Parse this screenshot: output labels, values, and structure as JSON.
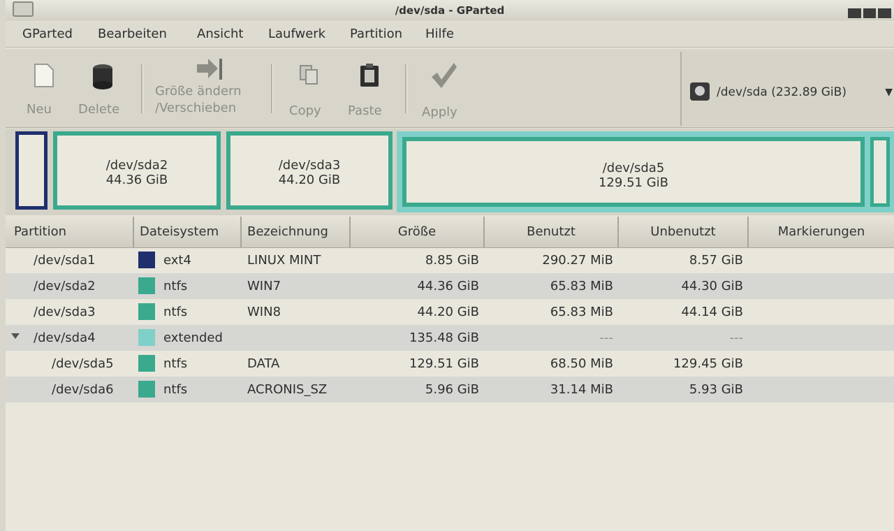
{
  "window": {
    "title": "/dev/sda - GParted"
  },
  "menu": {
    "items": [
      {
        "label": "GParted"
      },
      {
        "label": "Bearbeiten"
      },
      {
        "label": "Ansicht"
      },
      {
        "label": "Laufwerk"
      },
      {
        "label": "Partition"
      },
      {
        "label": "Hilfe"
      }
    ]
  },
  "toolbar": {
    "new_label": "Neu",
    "delete_label": "Delete",
    "resize_label_1": "Größe ändern",
    "resize_label_2": "/Verschieben",
    "copy_label": "Copy",
    "paste_label": "Paste",
    "apply_label": "Apply"
  },
  "device": {
    "label": "/dev/sda  (232.89 GiB)",
    "icon": "harddisk-icon"
  },
  "diskmap": {
    "partitions": [
      {
        "name": "/dev/sda2",
        "size": "44.36 GiB"
      },
      {
        "name": "/dev/sda3",
        "size": "44.20 GiB"
      },
      {
        "name": "/dev/sda5",
        "size": "129.51 GiB"
      }
    ]
  },
  "table": {
    "columns": [
      "Partition",
      "Dateisystem",
      "Bezeichnung",
      "Größe",
      "Benutzt",
      "Unbenutzt",
      "Markierungen"
    ],
    "rows": [
      {
        "partition": "/dev/sda1",
        "fs": "ext4",
        "label": "LINUX MINT",
        "size": "8.85 GiB",
        "used": "290.27 MiB",
        "unused": "8.57 GiB",
        "flags": "",
        "color": "#1f2f6e"
      },
      {
        "partition": "/dev/sda2",
        "fs": "ntfs",
        "label": "WIN7",
        "size": "44.36 GiB",
        "used": "65.83 MiB",
        "unused": "44.30 GiB",
        "flags": "",
        "color": "#3aa98e"
      },
      {
        "partition": "/dev/sda3",
        "fs": "ntfs",
        "label": "WIN8",
        "size": "44.20 GiB",
        "used": "65.83 MiB",
        "unused": "44.14 GiB",
        "flags": "",
        "color": "#3aa98e"
      },
      {
        "partition": "/dev/sda4",
        "fs": "extended",
        "label": "",
        "size": "135.48 GiB",
        "used": "---",
        "unused": "---",
        "flags": "",
        "color": "#7fd0c8"
      },
      {
        "partition": "/dev/sda5",
        "fs": "ntfs",
        "label": "DATA",
        "size": "129.51 GiB",
        "used": "68.50 MiB",
        "unused": "129.45 GiB",
        "flags": "",
        "color": "#3aa98e"
      },
      {
        "partition": "/dev/sda6",
        "fs": "ntfs",
        "label": "ACRONIS_SZ",
        "size": "5.96 GiB",
        "used": "31.14 MiB",
        "unused": "5.93 GiB",
        "flags": "",
        "color": "#3aa98e"
      }
    ]
  }
}
